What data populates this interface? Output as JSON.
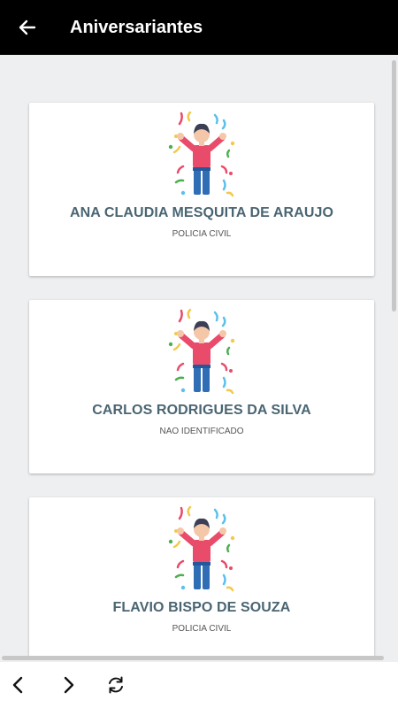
{
  "header": {
    "title": "Aniversariantes",
    "back_icon": "arrow-left-icon"
  },
  "birthdays": [
    {
      "name": "ANA CLAUDIA MESQUITA DE ARAUJO",
      "organization": "POLICIA CIVIL"
    },
    {
      "name": "CARLOS RODRIGUES DA SILVA",
      "organization": "NAO IDENTIFICADO"
    },
    {
      "name": "FLAVIO BISPO DE SOUZA",
      "organization": "POLICIA CIVIL"
    }
  ],
  "illustration_icon": "celebration-person-confetti-icon",
  "bottom_bar": {
    "back_icon": "chevron-left-icon",
    "forward_icon": "chevron-right-icon",
    "refresh_icon": "refresh-icon"
  },
  "colors": {
    "appbar": "#000000",
    "name_text": "#4a6572",
    "background": "#eeeff1"
  }
}
